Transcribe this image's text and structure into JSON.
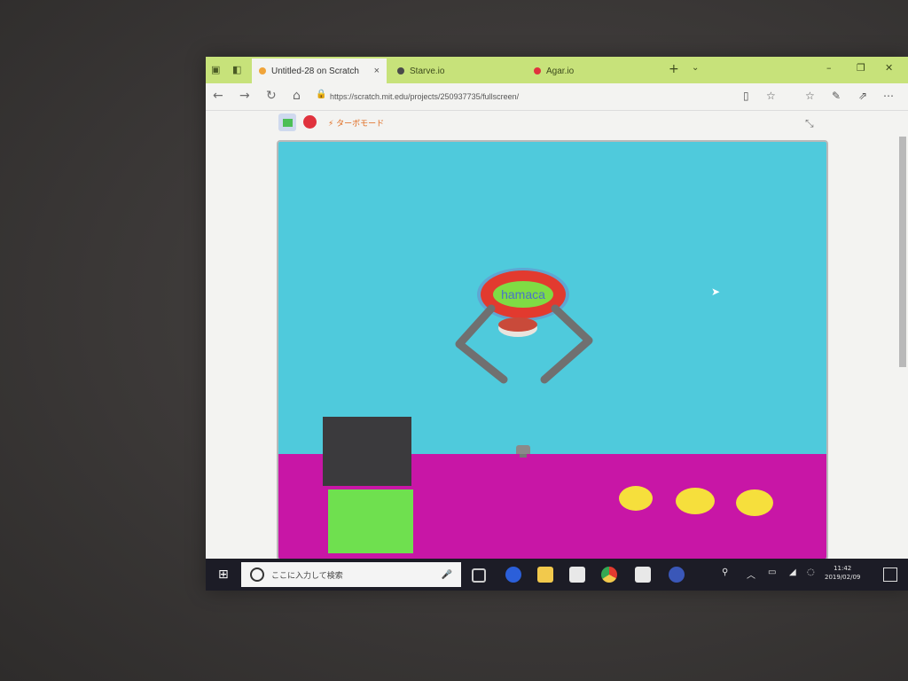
{
  "browser": {
    "tabs": [
      {
        "label": "Untitled-28 on Scratch",
        "active": true,
        "favicon_color": "#f0a43a"
      },
      {
        "label": "Starve.io",
        "active": false,
        "favicon_color": "#4a4a4a"
      },
      {
        "label": "Agar.io",
        "active": false,
        "favicon_color": "#e0323d"
      }
    ],
    "tab_close": "×",
    "new_tab": "+",
    "tab_menu": "⌄",
    "window_controls": {
      "minimize": "–",
      "restore": "❐",
      "close": "✕"
    },
    "nav": {
      "back": "←",
      "forward": "→",
      "refresh": "↻",
      "home": "⌂"
    },
    "url": "https://scratch.mit.edu/projects/250937735/fullscreen/",
    "lock": "🔒",
    "toolbar": {
      "reading": "▯",
      "favorite": "☆",
      "favorites_list": "☆",
      "notes": "✎",
      "share": "⇗",
      "more": "⋯"
    }
  },
  "scratch": {
    "turbo_label": "⚡ ターボモード",
    "fullscreen_icon": "⤡",
    "stage": {
      "sky_color": "#4fcadc",
      "ground_color": "#c816a6",
      "claw_label": "hamaca",
      "coins_count": 3
    }
  },
  "taskbar": {
    "start_icon": "⊞",
    "search_placeholder": "ここに入力して検索",
    "mic": "🎤",
    "clock_time": "11:42",
    "clock_date": "2019/02/09"
  }
}
